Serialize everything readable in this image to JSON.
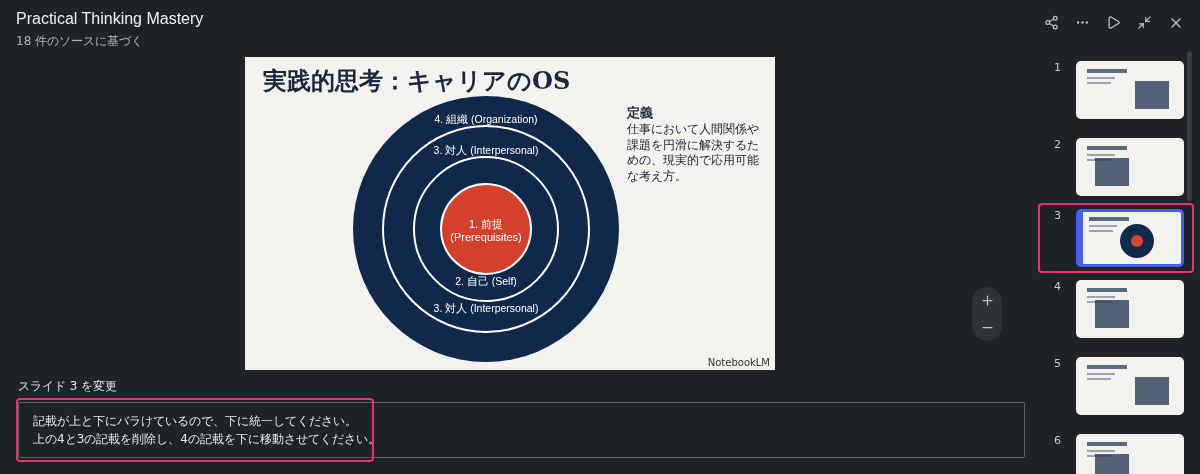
{
  "header": {
    "title": "Practical Thinking Mastery",
    "subtitle": "18 件のソースに基づく"
  },
  "slide": {
    "title": "実践的思考：キャリアのOS",
    "definition_heading": "定義",
    "definition": "仕事において人間関係や課題を円滑に解決するための、現実的で応用可能な考え方。",
    "rings": [
      {
        "label": "4. 組織 (Organization)"
      },
      {
        "label": "3. 対人 (Interpersonal)"
      },
      {
        "label": "2. 自己 (Self)"
      },
      {
        "label": "3. 対人 (Interpersonal)"
      }
    ],
    "center": [
      "1. 前提",
      "(Prerequisites)"
    ],
    "brand": "NotebookLM"
  },
  "change": {
    "label": "スライド 3 を変更",
    "lines": [
      "記載が上と下にバラけているので、下に統一してください。",
      "上の4と3の記載を削除し、4の記載を下に移動させてください。"
    ],
    "highlighted": true
  },
  "thumbnails": [
    {
      "number": "1",
      "selected": false,
      "highlighted": false
    },
    {
      "number": "2",
      "selected": false,
      "highlighted": false
    },
    {
      "number": "3",
      "selected": true,
      "highlighted": true
    },
    {
      "number": "4",
      "selected": false,
      "highlighted": false
    },
    {
      "number": "5",
      "selected": false,
      "highlighted": false
    },
    {
      "number": "6",
      "selected": false,
      "highlighted": false
    }
  ]
}
